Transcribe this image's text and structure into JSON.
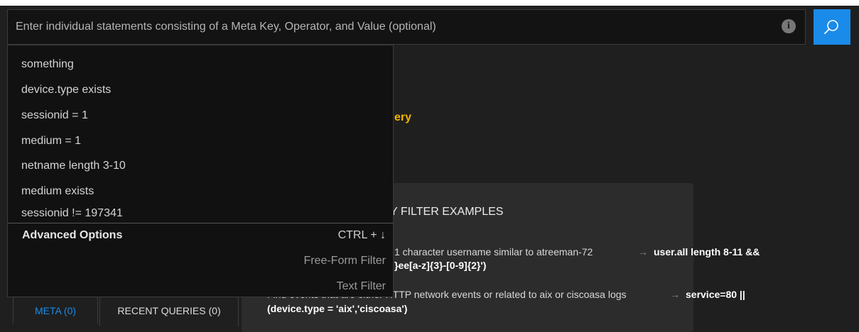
{
  "query_bar": {
    "placeholder": "Enter individual statements consisting of a Meta Key, Operator, and Value (optional)",
    "info_icon_glyph": "i"
  },
  "icons": {
    "search": "search-icon",
    "info": "info-icon"
  },
  "colors": {
    "accent_blue": "#1a8be8",
    "heading_yellow": "#f0b400",
    "background": "#1f1f1f"
  },
  "dropdown": {
    "suggestions": [
      "something",
      "device.type exists",
      "sessionid = 1",
      "medium = 1",
      "netname length 3-10",
      "medium exists",
      "sessionid != 197341"
    ],
    "advanced_options_label": "Advanced Options",
    "advanced_options_shortcut": "CTRL + ↓",
    "free_form_filter": "Free-Form Filter",
    "text_filter": "Text Filter"
  },
  "main": {
    "heading_fragment": "ery",
    "examples_title_fragment": "Y FILTER EXAMPLES",
    "example1_text": "1 character username similar to atreeman-72",
    "example1_code_a": "user.all length 8-11 &&",
    "example1_code_b": "}ee[a-z]{3}-[0-9]{2}')",
    "example2_text": "Find events that are either HTTP network events or related to aix or ciscoasa logs",
    "example2_code_a": "service=80 ||",
    "example2_code_b": "(device.type = 'aix','ciscoasa')"
  },
  "tabs": {
    "meta_label": "META (0)",
    "recent_queries_label": "RECENT QUERIES (0)"
  }
}
